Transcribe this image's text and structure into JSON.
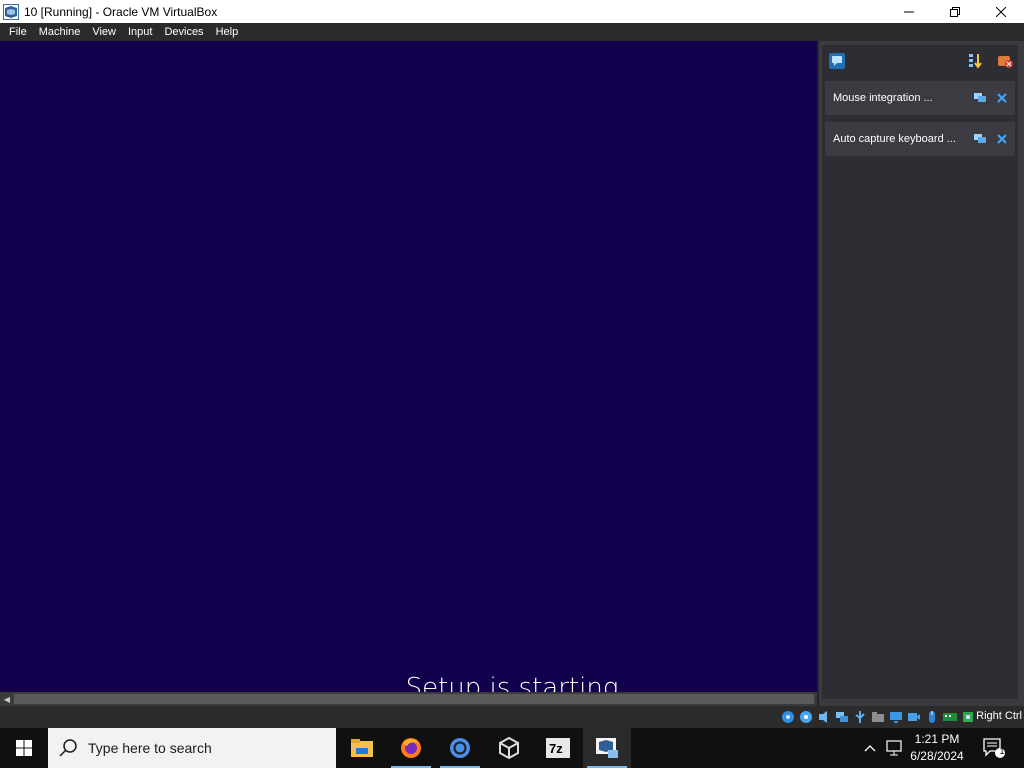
{
  "window": {
    "title": "10 [Running] - Oracle VM VirtualBox"
  },
  "menu": [
    "File",
    "Machine",
    "View",
    "Input",
    "Devices",
    "Help"
  ],
  "vm": {
    "message": "Setup is starting",
    "background": "#12004d"
  },
  "notifications": [
    {
      "text": "Mouse integration ..."
    },
    {
      "text": "Auto capture keyboard ..."
    }
  ],
  "statusbar": {
    "host_key": "Right Ctrl"
  },
  "taskbar": {
    "search_placeholder": "Type here to search",
    "apps": [
      "file-explorer-icon",
      "firefox-icon",
      "chrome-icon",
      "virtualbox-icon",
      "7zip-icon",
      "virtualbox-vm-icon"
    ],
    "app_7zip_label": "7z",
    "time": "1:21 PM",
    "date": "6/28/2024",
    "notification_count": "1"
  },
  "colors": {
    "accent": "#76b9ed",
    "menubar": "#2b2b2b",
    "panel": "#2e2d33"
  }
}
